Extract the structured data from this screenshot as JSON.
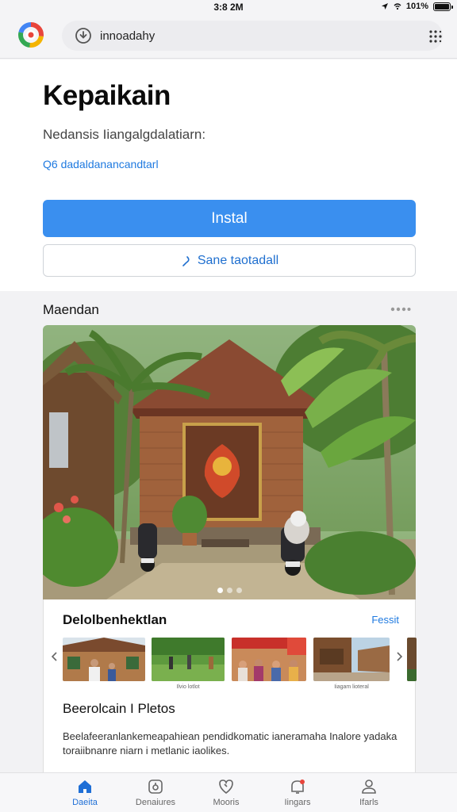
{
  "status_bar": {
    "time": "3:8 2M",
    "battery": "101%"
  },
  "browser": {
    "url": "innoadahy",
    "icons": {
      "app": "multicolor-app-logo",
      "url": "download-circle-icon",
      "menu": "grid-dots-icon"
    }
  },
  "app": {
    "title": "Kepaikain",
    "subtitle": "Nedansis Iiangalgdalatiarn:",
    "developer_link": "Q6 dadaldanancandtarl"
  },
  "buttons": {
    "install": "Instal",
    "share": "Sane taotadall"
  },
  "media": {
    "section_title": "Maendan",
    "carousel": {
      "count": 3,
      "active_index": 0
    }
  },
  "details": {
    "title": "Delolbenhektlan",
    "link": "Fessit",
    "thumbnails": [
      {
        "caption": ""
      },
      {
        "caption": "Ilvio lotlot"
      },
      {
        "caption": ""
      },
      {
        "caption": "Iiagam lioteral"
      }
    ],
    "desc_title": "Beerolcain I Pletos",
    "desc_text": "Beelafeeranlankemeapahiean pendidkomatic ianeramaha Inalore yadaka toraiibnanre niarn i metlanic iaolikes."
  },
  "nav": {
    "items": [
      {
        "label": "Daeita",
        "icon": "home-icon"
      },
      {
        "label": "Denaiures",
        "icon": "lock-icon"
      },
      {
        "label": "Mooris",
        "icon": "heart-shield-icon"
      },
      {
        "label": "Iingars",
        "icon": "bell-icon"
      },
      {
        "label": "Ifarls",
        "icon": "profile-icon"
      }
    ],
    "active_index": 0
  },
  "colors": {
    "accent": "#3a8fef",
    "link": "#1f7ae0",
    "background": "#f2f2f4",
    "card": "#ffffff"
  }
}
